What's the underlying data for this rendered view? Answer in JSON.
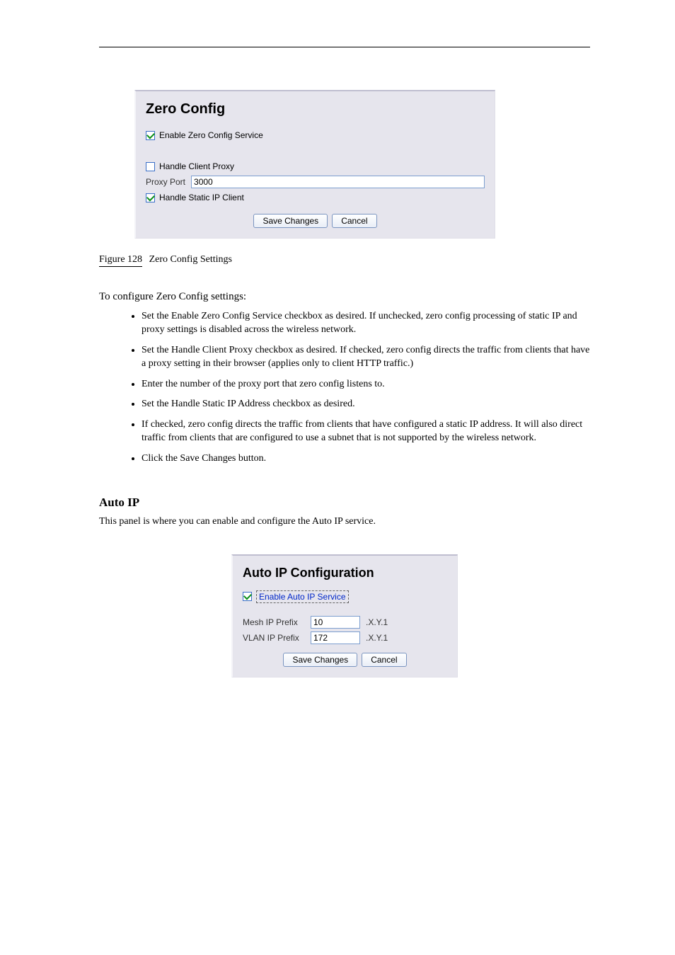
{
  "header": {
    "spacer": ""
  },
  "zeroConfig": {
    "title": "Zero Config",
    "enable_label": "Enable Zero Config Service",
    "handle_proxy_label": "Handle Client Proxy",
    "proxy_port_label": "Proxy Port",
    "proxy_port_value": "3000",
    "handle_static_label": "Handle Static IP Client",
    "save_label": "Save Changes",
    "cancel_label": "Cancel"
  },
  "figure_caption": {
    "label": "Figure 128",
    "text": "Zero Config Settings"
  },
  "to_heading": "To configure Zero Config settings:",
  "bullets": {
    "b1": "Set the Enable Zero Config Service checkbox as desired. If unchecked, zero config processing of static IP and proxy settings is disabled across the wireless network.",
    "b2": "Set the Handle Client Proxy checkbox as desired. If checked, zero config directs the traffic from clients that have a proxy setting in their browser (applies only to client HTTP traffic.)",
    "b3": "Enter the number of the proxy port that zero config listens to.",
    "b4": "Set the Handle Static IP Address checkbox as desired.",
    "b5": "If checked, zero config directs the traffic from clients that have configured a static IP address. It will also direct traffic from clients that are configured to use a subnet that is not supported by the wireless network.",
    "b6": "Click the Save Changes button."
  },
  "autoIP_section": {
    "title": "Auto IP",
    "para": "This panel is where you can enable and configure the Auto IP service."
  },
  "autoIP": {
    "title": "Auto IP Configuration",
    "enable_label": "Enable Auto IP Service",
    "mesh_label": "Mesh IP Prefix",
    "mesh_value": "10",
    "mesh_suffix": ".X.Y.1",
    "vlan_label": "VLAN IP Prefix",
    "vlan_value": "172",
    "vlan_suffix": ".X.Y.1",
    "save_label": "Save Changes",
    "cancel_label": "Cancel"
  }
}
